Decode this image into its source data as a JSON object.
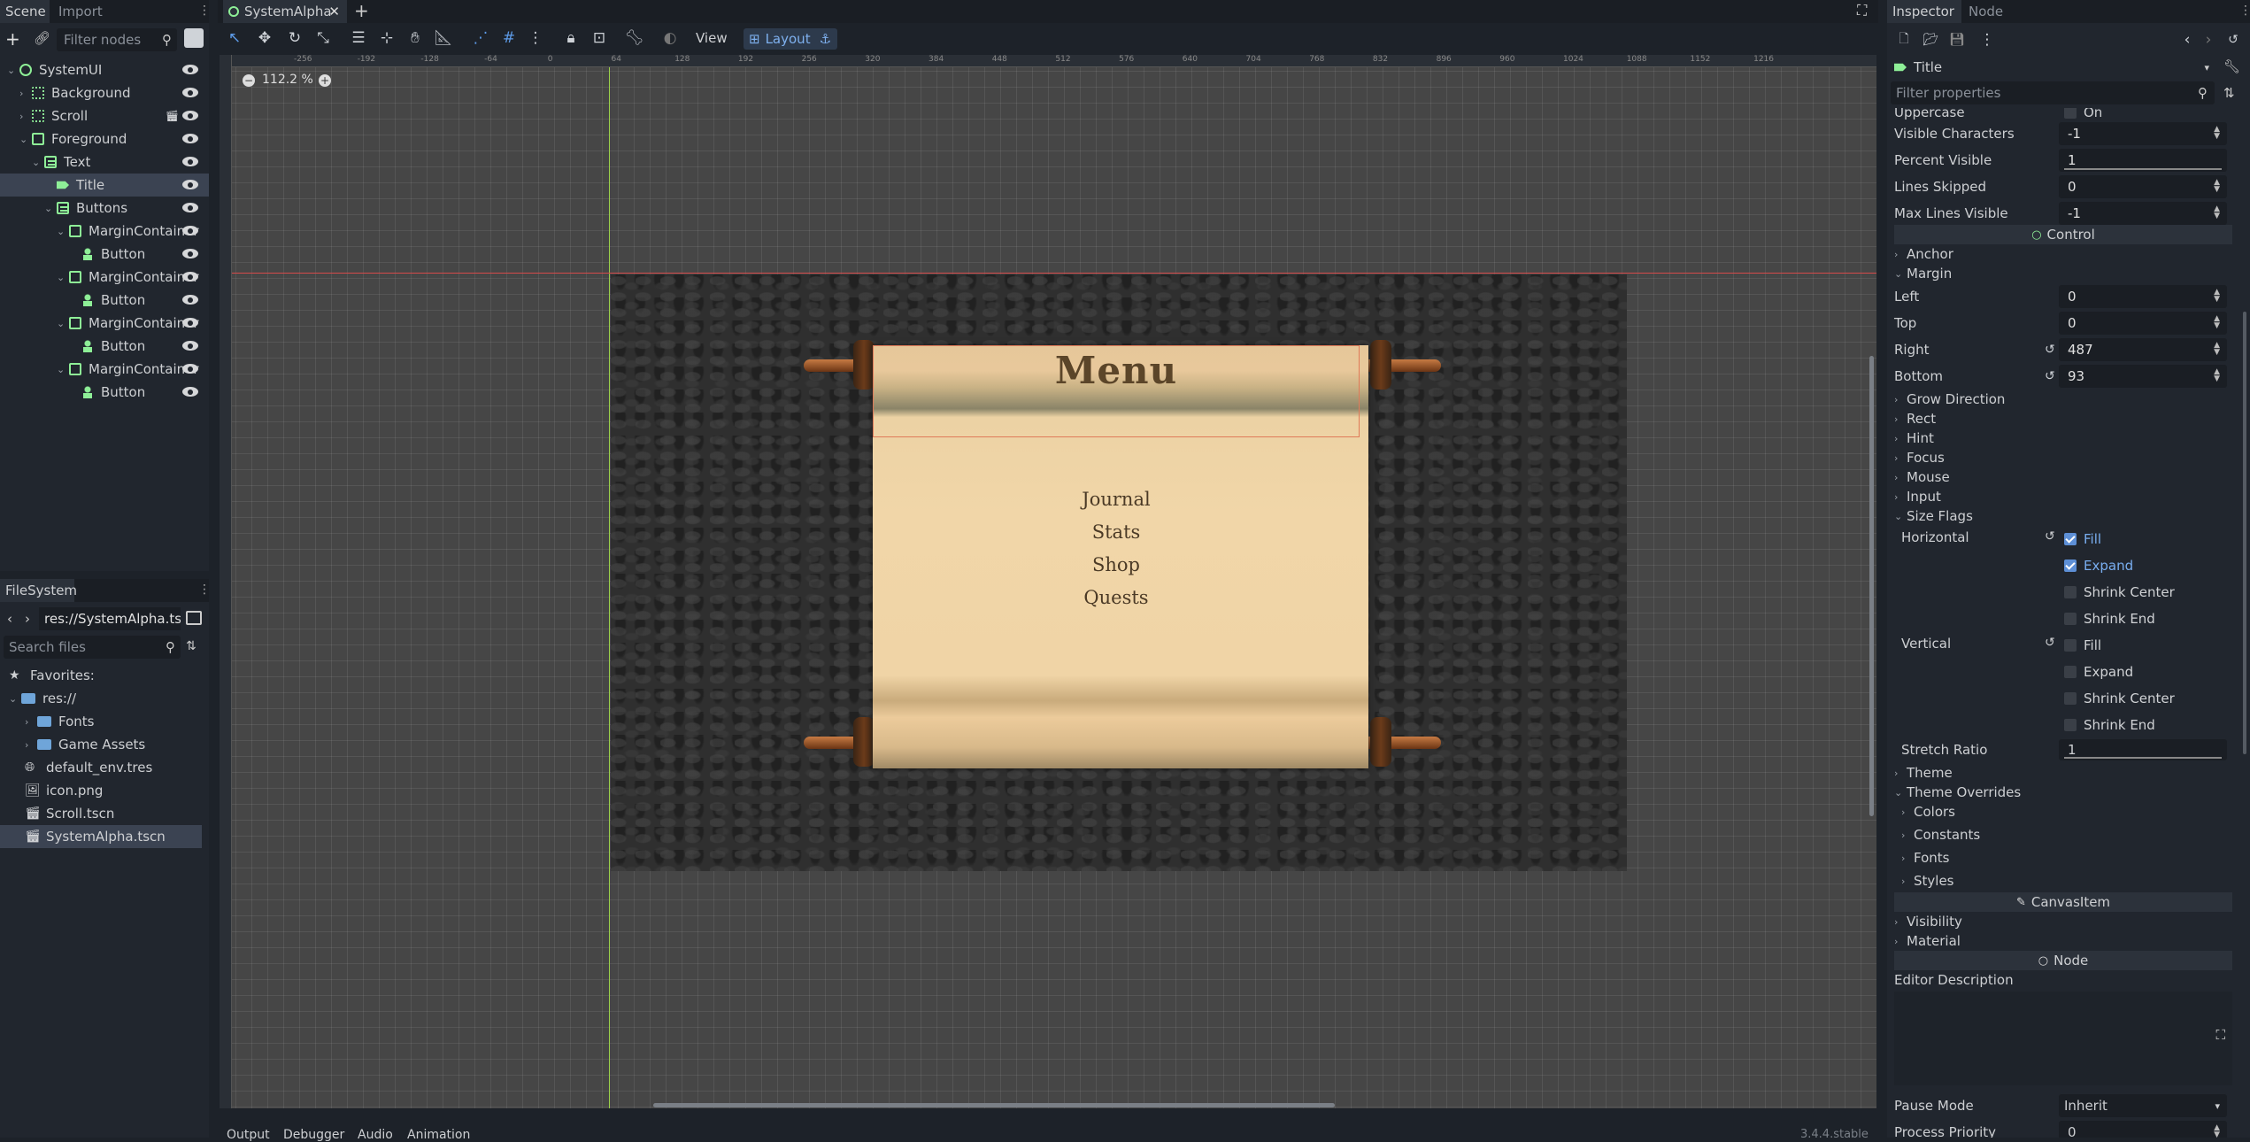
{
  "scene_dock": {
    "tabs": [
      "Scene",
      "Import"
    ],
    "filter_placeholder": "Filter nodes",
    "tree": [
      {
        "label": "SystemUI",
        "icon": "control-icon",
        "depth": 0,
        "expanded": true
      },
      {
        "label": "Background",
        "icon": "texture-rect-icon",
        "depth": 1,
        "expanded": false
      },
      {
        "label": "Scroll",
        "icon": "texture-rect-icon",
        "depth": 1,
        "expanded": false,
        "extra_icon": "scene-instance-icon"
      },
      {
        "label": "Foreground",
        "icon": "control-icon",
        "depth": 1,
        "expanded": true
      },
      {
        "label": "Text",
        "icon": "vbox-icon",
        "depth": 2,
        "expanded": true
      },
      {
        "label": "Title",
        "icon": "label-icon",
        "depth": 3,
        "selected": true
      },
      {
        "label": "Buttons",
        "icon": "vbox-icon",
        "depth": 3,
        "expanded": true
      },
      {
        "label": "MarginContainer",
        "icon": "control-icon",
        "depth": 4,
        "expanded": true
      },
      {
        "label": "Button",
        "icon": "button-icon",
        "depth": 5
      },
      {
        "label": "MarginContainer",
        "icon": "control-icon",
        "depth": 4,
        "expanded": true
      },
      {
        "label": "Button",
        "icon": "button-icon",
        "depth": 5
      },
      {
        "label": "MarginContainer",
        "icon": "control-icon",
        "depth": 4,
        "expanded": true
      },
      {
        "label": "Button",
        "icon": "button-icon",
        "depth": 5
      },
      {
        "label": "MarginContainer",
        "icon": "control-icon",
        "depth": 4,
        "expanded": true
      },
      {
        "label": "Button",
        "icon": "button-icon",
        "depth": 5
      }
    ]
  },
  "filesystem_dock": {
    "title": "FileSystem",
    "path": "res://SystemAlpha.tsc",
    "search_placeholder": "Search files",
    "items": [
      {
        "label": "Favorites:",
        "icon": "star-icon",
        "depth": 0
      },
      {
        "label": "res://",
        "icon": "folder-icon",
        "depth": 0
      },
      {
        "label": "Fonts",
        "icon": "folder-icon",
        "depth": 1
      },
      {
        "label": "Game Assets",
        "icon": "folder-icon",
        "depth": 1
      },
      {
        "label": "default_env.tres",
        "icon": "environment-icon",
        "depth": 1
      },
      {
        "label": "icon.png",
        "icon": "image-icon",
        "depth": 1
      },
      {
        "label": "Scroll.tscn",
        "icon": "scene-icon",
        "depth": 1
      },
      {
        "label": "SystemAlpha.tscn",
        "icon": "scene-icon",
        "depth": 1,
        "selected": true
      }
    ]
  },
  "editor": {
    "scene_tab": "SystemAlpha",
    "view_label": "View",
    "layout_label": "Layout",
    "zoom": "112.2 %",
    "bottom_tabs": [
      "Output",
      "Debugger",
      "Audio",
      "Animation"
    ],
    "version": "3.4.4.stable",
    "ruler_labels": [
      "-256",
      "-192",
      "-128",
      "-64",
      "0",
      "64",
      "128",
      "192",
      "256",
      "320",
      "384",
      "448",
      "512",
      "576",
      "640",
      "704",
      "768",
      "832",
      "896",
      "960",
      "1024",
      "1088",
      "1152",
      "1216"
    ]
  },
  "game_menu": {
    "title": "Menu",
    "items": [
      "Journal",
      "Stats",
      "Shop",
      "Quests"
    ]
  },
  "inspector": {
    "tabs": [
      "Inspector",
      "Node"
    ],
    "node_name": "Title",
    "filter_placeholder": "Filter properties",
    "props_top": [
      {
        "key": "Uppercase",
        "value": "On",
        "type": "check"
      },
      {
        "key": "Visible Characters",
        "value": "-1",
        "type": "spin"
      },
      {
        "key": "Percent Visible",
        "value": "1",
        "type": "slider"
      },
      {
        "key": "Lines Skipped",
        "value": "0",
        "type": "spin"
      },
      {
        "key": "Max Lines Visible",
        "value": "-1",
        "type": "spin"
      }
    ],
    "cat_control": "Control",
    "anchor": "Anchor",
    "margin": "Margin",
    "margin_props": [
      {
        "key": "Left",
        "value": "0"
      },
      {
        "key": "Top",
        "value": "0"
      },
      {
        "key": "Right",
        "value": "487"
      },
      {
        "key": "Bottom",
        "value": "93"
      }
    ],
    "sections": [
      "Grow Direction",
      "Rect",
      "Hint",
      "Focus",
      "Mouse",
      "Input"
    ],
    "size_flags": "Size Flags",
    "horizontal": "Horizontal",
    "vertical": "Vertical",
    "h_flags": [
      {
        "label": "Fill",
        "on": true
      },
      {
        "label": "Expand",
        "on": true
      },
      {
        "label": "Shrink Center",
        "on": false
      },
      {
        "label": "Shrink End",
        "on": false
      }
    ],
    "v_flags": [
      {
        "label": "Fill",
        "on": false
      },
      {
        "label": "Expand",
        "on": false
      },
      {
        "label": "Shrink Center",
        "on": false
      },
      {
        "label": "Shrink End",
        "on": false
      }
    ],
    "stretch_ratio_label": "Stretch Ratio",
    "stretch_ratio": "1",
    "theme": "Theme",
    "theme_overrides": "Theme Overrides",
    "override_sections": [
      "Colors",
      "Constants",
      "Fonts",
      "Styles"
    ],
    "cat_canvas": "CanvasItem",
    "visibility": "Visibility",
    "material": "Material",
    "cat_node": "Node",
    "editor_description": "Editor Description",
    "pause_mode_label": "Pause Mode",
    "pause_mode": "Inherit",
    "process_priority_label": "Process Priority",
    "process_priority": "0"
  }
}
